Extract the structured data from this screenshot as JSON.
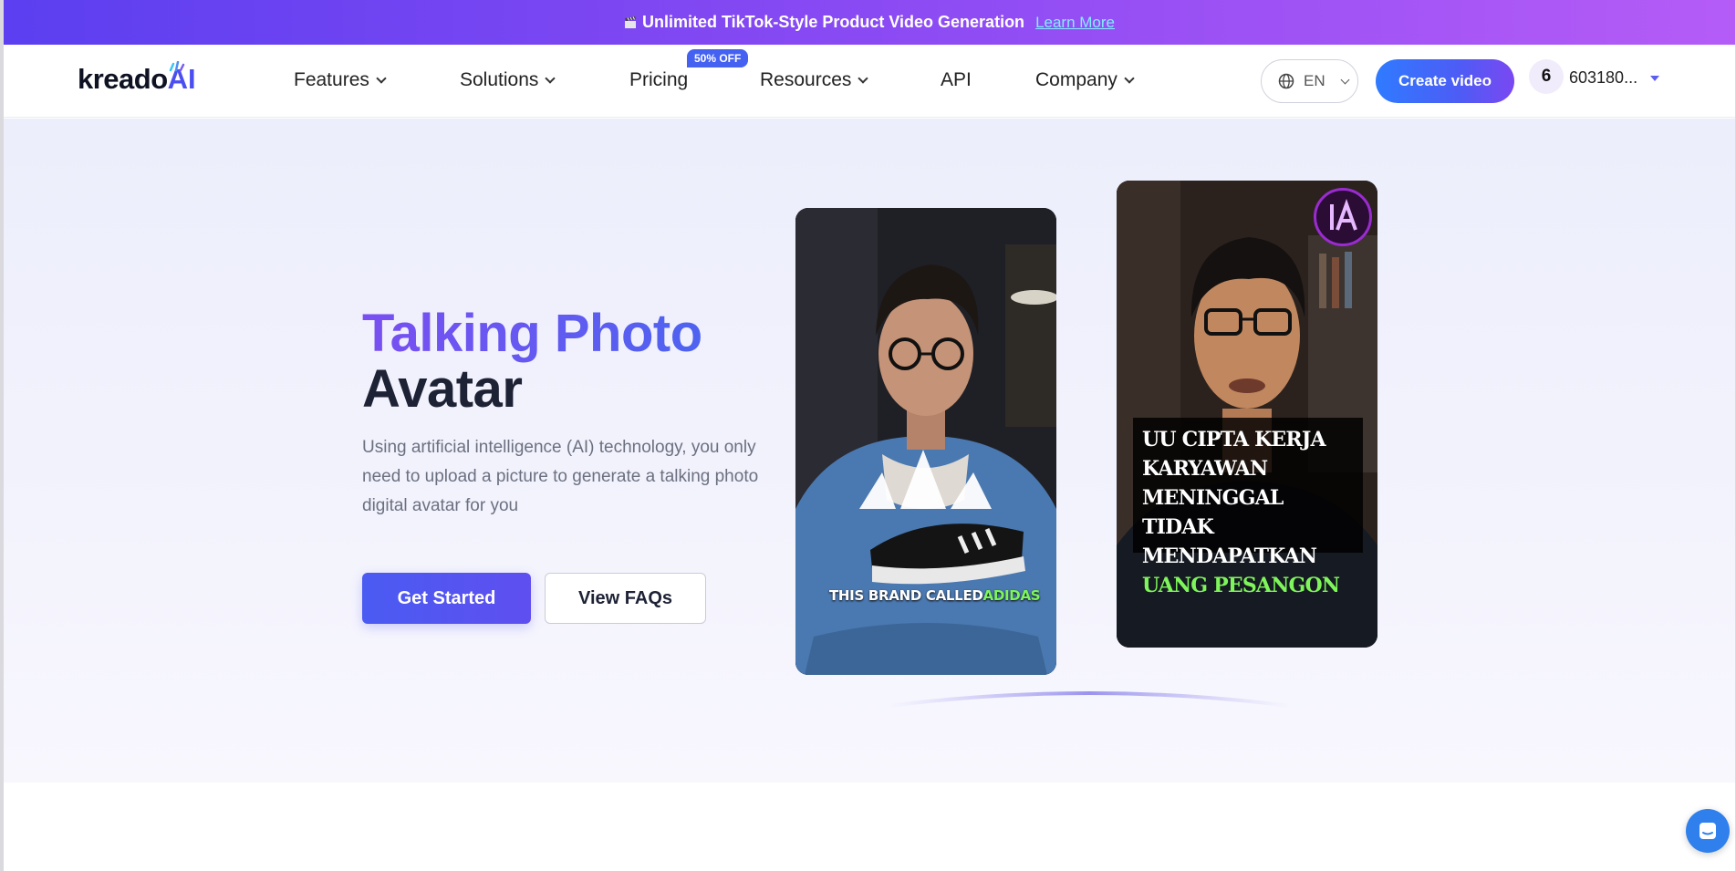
{
  "banner": {
    "text": "Unlimited TikTok-Style Product Video Generation",
    "link_label": "Learn More",
    "icon": "clapperboard-icon"
  },
  "nav": {
    "logo_text": "kreado",
    "logo_ai": "AI",
    "items": [
      {
        "label": "Features",
        "has_dropdown": true
      },
      {
        "label": "Solutions",
        "has_dropdown": true
      },
      {
        "label": "Pricing",
        "has_dropdown": false,
        "badge": "50% OFF"
      },
      {
        "label": "Resources",
        "has_dropdown": true
      },
      {
        "label": "API",
        "has_dropdown": false
      },
      {
        "label": "Company",
        "has_dropdown": true
      }
    ],
    "language": "EN",
    "create_label": "Create video",
    "avatar_initial": "6",
    "username": "603180..."
  },
  "hero": {
    "title_line1": "Talking Photo",
    "title_line2": "Avatar",
    "description": "Using artificial intelligence (AI) technology, you only need to upload a picture to generate a talking photo digital avatar for you",
    "primary_cta": "Get Started",
    "secondary_cta": "View FAQs"
  },
  "cards": [
    {
      "caption_prefix": "THIS BRAND CALLED",
      "caption_highlight": "ADIDAS"
    },
    {
      "caption_lines": [
        "UU CIPTA KERJA",
        "KARYAWAN MENINGGAL",
        "TIDAK MENDAPATKAN"
      ],
      "caption_highlight": "UANG PESANGON"
    }
  ],
  "colors": {
    "accent": "#4c4ff0",
    "banner_start": "#5b3ff0",
    "banner_end": "#b55cf7",
    "highlight_green": "#7ef55a",
    "chat": "#2f80ed"
  }
}
